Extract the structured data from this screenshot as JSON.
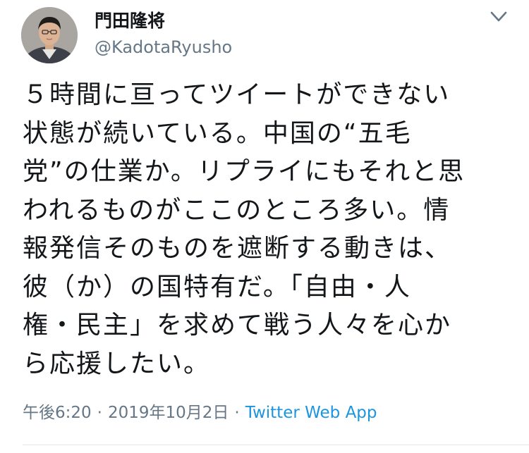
{
  "user": {
    "display_name": "門田隆将",
    "handle": "@KadotaRyusho"
  },
  "tweet": {
    "lines": [
      "５時間に亘ってツイートができない",
      "状態が続いている。中国の“五毛",
      "党”の仕業か。リプライにもそれと思",
      "われるものがここのところ多い。情",
      "報発信そのものを遮断する動きは、",
      "彼（か）の国特有だ。「自由・人",
      "権・民主」を求めて戦う人々を心か",
      "ら応援したい。"
    ]
  },
  "meta": {
    "time": "午後6:20",
    "separator": "·",
    "date": "2019年10月2日",
    "source": "Twitter Web App"
  },
  "icons": {
    "menu": "chevron-down-icon",
    "avatar": "user-avatar"
  },
  "colors": {
    "text": "#14171a",
    "secondary": "#657786",
    "link": "#1b95e0",
    "divider": "#e1e8ed"
  }
}
